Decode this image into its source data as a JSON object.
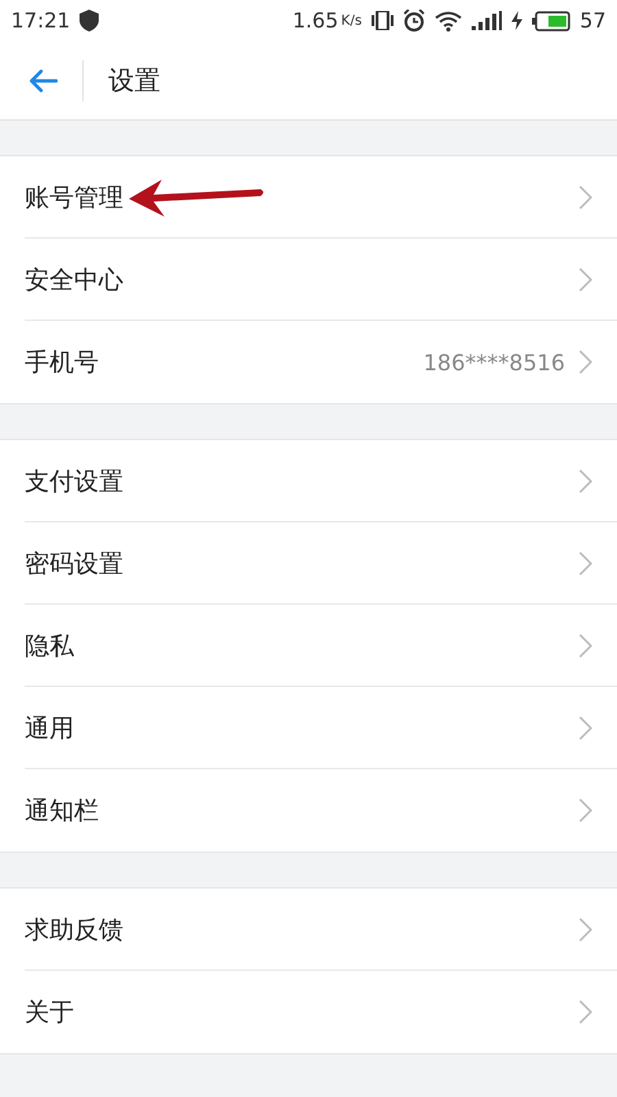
{
  "status_bar": {
    "time": "17:21",
    "speed": "1.65",
    "speed_unit": "K/s",
    "battery": "57"
  },
  "header": {
    "title": "设置"
  },
  "groups": [
    {
      "items": [
        {
          "label": "账号管理",
          "marked": true
        },
        {
          "label": "安全中心",
          "marked": false
        },
        {
          "label": "手机号",
          "value": "186****8516",
          "marked": false
        }
      ]
    },
    {
      "items": [
        {
          "label": "支付设置",
          "marked": false
        },
        {
          "label": "密码设置",
          "marked": false
        },
        {
          "label": "隐私",
          "marked": false
        },
        {
          "label": "通用",
          "marked": false
        },
        {
          "label": "通知栏",
          "marked": false
        }
      ]
    },
    {
      "items": [
        {
          "label": "求助反馈",
          "marked": false
        },
        {
          "label": "关于",
          "marked": false
        }
      ]
    }
  ]
}
